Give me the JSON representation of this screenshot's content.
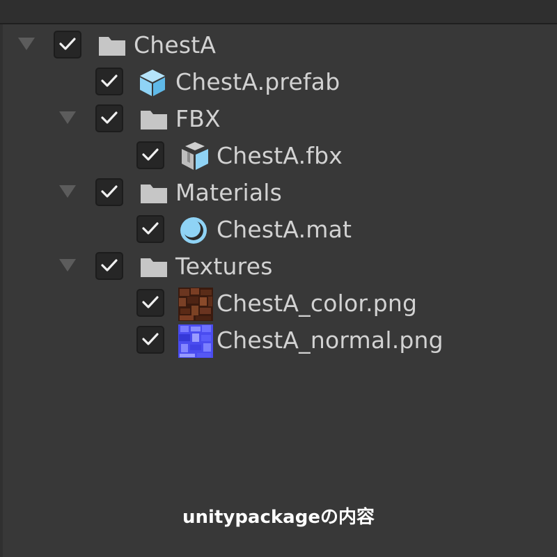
{
  "tree": [
    {
      "label": "ChestA",
      "icon": "folder-icon",
      "checked": true,
      "expanded": true
    },
    {
      "label": "ChestA.prefab",
      "icon": "prefab-cube-icon",
      "checked": true
    },
    {
      "label": "FBX",
      "icon": "folder-icon",
      "checked": true,
      "expanded": true
    },
    {
      "label": "ChestA.fbx",
      "icon": "model-fbx-icon",
      "checked": true
    },
    {
      "label": "Materials",
      "icon": "folder-icon",
      "checked": true,
      "expanded": true
    },
    {
      "label": "ChestA.mat",
      "icon": "material-sphere-icon",
      "checked": true
    },
    {
      "label": "Textures",
      "icon": "folder-icon",
      "checked": true,
      "expanded": true
    },
    {
      "label": "ChestA_color.png",
      "icon": "texture-color-thumbnail",
      "checked": true
    },
    {
      "label": "ChestA_normal.png",
      "icon": "texture-normal-thumbnail",
      "checked": true
    }
  ],
  "caption": "unitypackageの内容",
  "colors": {
    "background": "#383838",
    "text": "#d2d2d2",
    "folder": "#c6c6c6",
    "unity_blue": "#8fd3f5",
    "checkbox_bg": "#262626"
  }
}
